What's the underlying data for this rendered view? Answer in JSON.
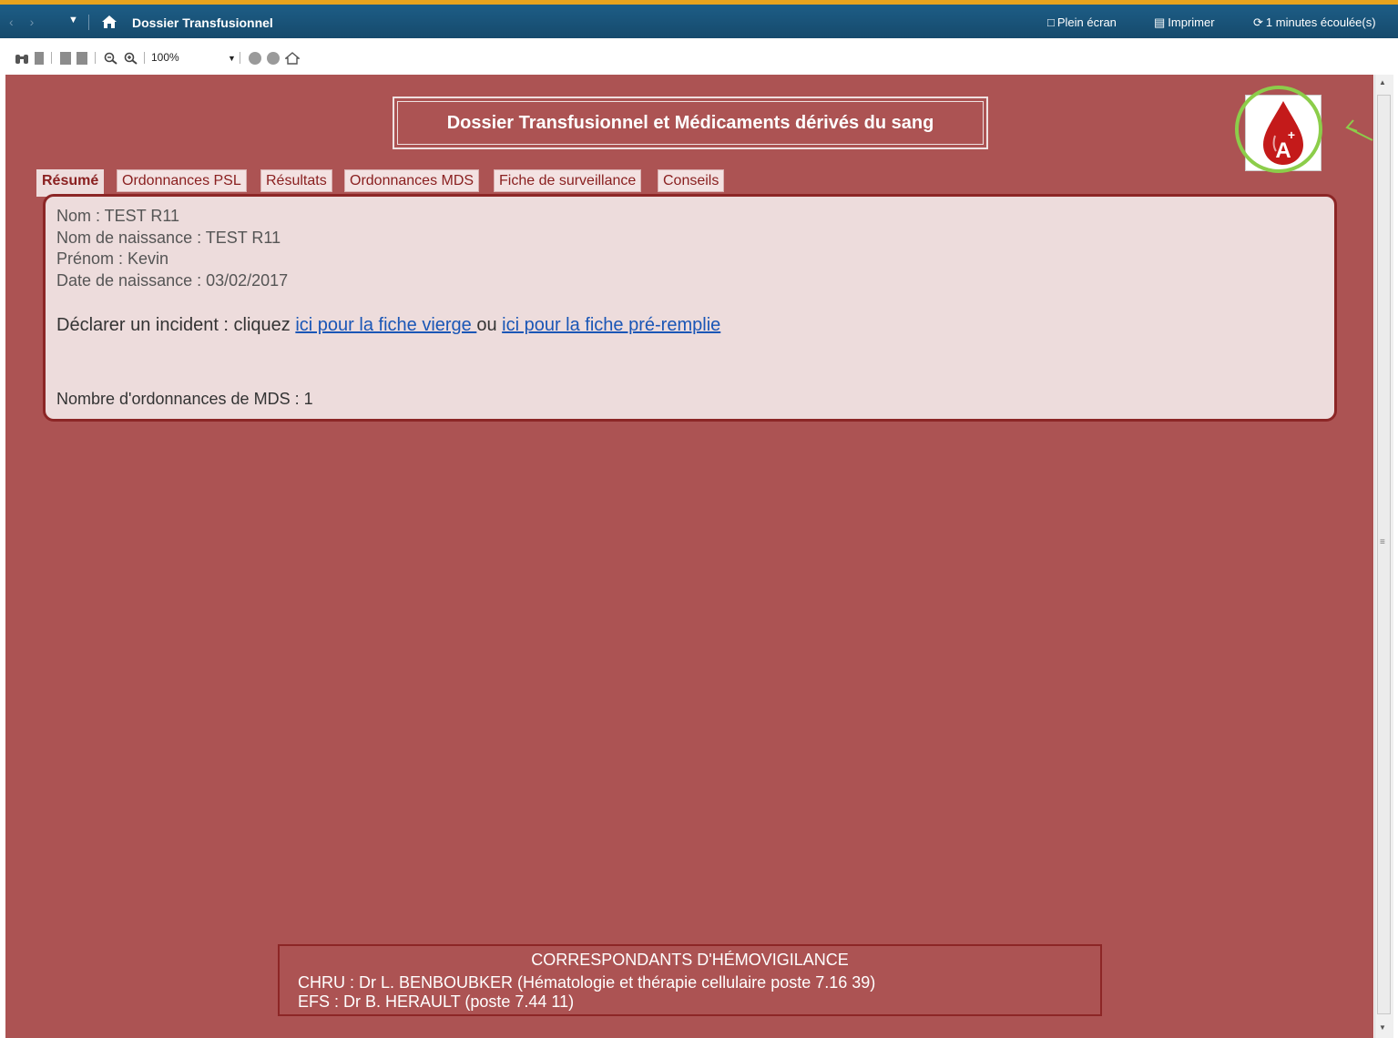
{
  "titlebar": {
    "title": "Dossier Transfusionnel",
    "fullscreen_label": "Plein écran",
    "print_label": "Imprimer",
    "elapsed_label": "1 minutes écoulée(s)"
  },
  "toolbar": {
    "zoom_value": "100%"
  },
  "page": {
    "heading": "Dossier Transfusionnel et Médicaments dérivés du sang",
    "logo_letter": "A",
    "logo_sign": "+"
  },
  "tabs": [
    {
      "label": "Résumé",
      "active": true
    },
    {
      "label": "Ordonnances PSL"
    },
    {
      "label": "Résultats"
    },
    {
      "label": "Ordonnances MDS"
    },
    {
      "label": "Fiche de surveillance"
    },
    {
      "label": "Conseils"
    }
  ],
  "summary": {
    "nom": "Nom : TEST R11",
    "nom_naissance": "Nom de naissance : TEST R11",
    "prenom": "Prénom : Kevin",
    "date_naissance": "Date de naissance : 03/02/2017",
    "incident_prefix": "Déclarer un incident : cliquez ",
    "incident_link1": "ici pour la fiche vierge ",
    "incident_or": "ou ",
    "incident_link2": "ici pour la fiche pré-remplie",
    "mds_count": "Nombre d'ordonnances de MDS : 1"
  },
  "footer": {
    "title": "CORRESPONDANTS D'HÉMOVIGILANCE",
    "line1": "CHRU : Dr L. BENBOUBKER (Hématologie et thérapie cellulaire poste 7.16 39)",
    "line2": "EFS : Dr B. HERAULT (poste 7.44 11)"
  },
  "colors": {
    "content_bg": "#ac5353",
    "panel_bg": "#eddcdc",
    "titlebar_bg": "#1d5d86",
    "link": "#1a56b6",
    "highlight_ring": "#8ccd4a"
  }
}
